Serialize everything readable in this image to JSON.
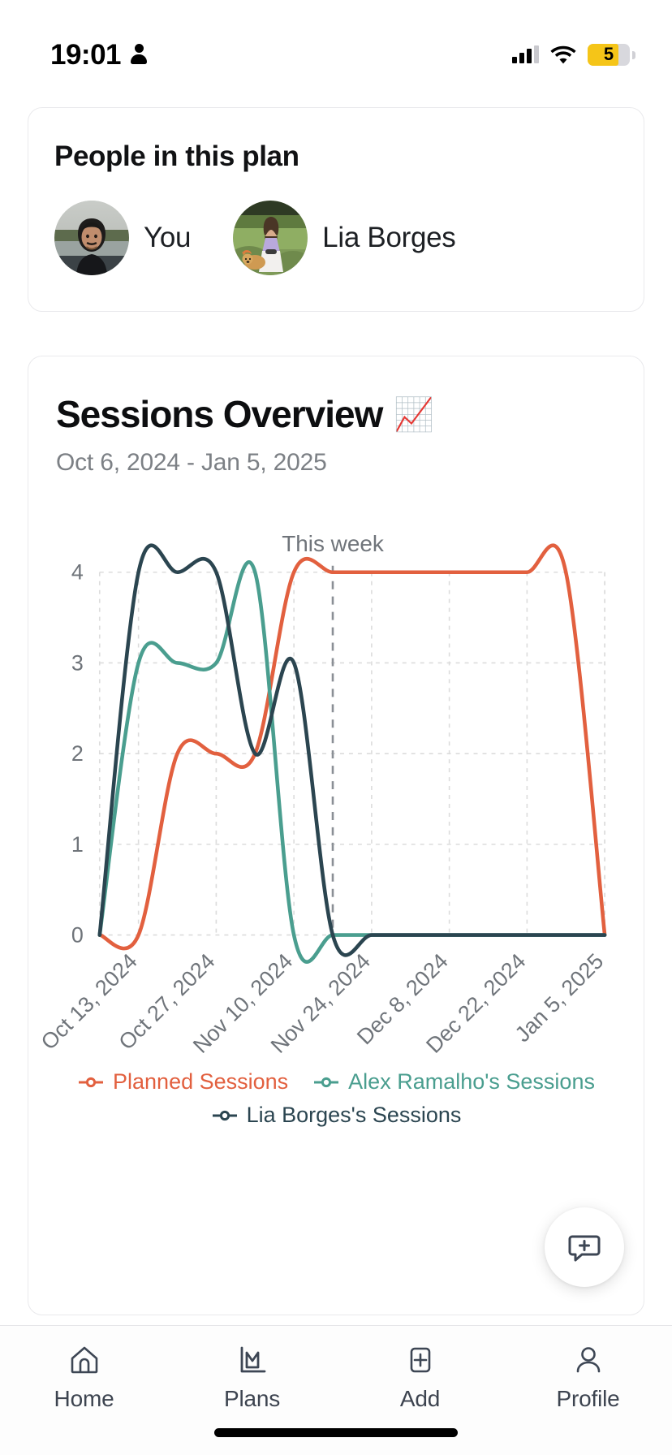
{
  "status_bar": {
    "time": "19:01",
    "person_icon": "person-icon",
    "signal_icon": "cellular-signal-icon",
    "wifi_icon": "wifi-icon",
    "battery_level": "5",
    "battery_color": "#f5c518"
  },
  "people_card": {
    "title": "People in this plan",
    "members": [
      {
        "name": "You",
        "avatar": "avatar-you"
      },
      {
        "name": "Lia Borges",
        "avatar": "avatar-lia-borges"
      }
    ]
  },
  "chart_card": {
    "title": "Sessions Overview",
    "title_emoji": "📈",
    "date_range": "Oct 6, 2024 - Jan 5, 2025"
  },
  "fab": {
    "icon": "chat-add-icon",
    "label": ""
  },
  "tab_bar": {
    "items": [
      {
        "label": "Home",
        "icon": "home-icon",
        "active": false
      },
      {
        "label": "Plans",
        "icon": "chart-icon",
        "active": true
      },
      {
        "label": "Add",
        "icon": "plus-square-icon",
        "active": false
      },
      {
        "label": "Profile",
        "icon": "person-outline-icon",
        "active": false
      }
    ]
  },
  "chart_data": {
    "type": "line",
    "title": "Sessions Overview",
    "subtitle": "Oct 6, 2024 - Jan 5, 2025",
    "xlabel": "",
    "ylabel": "",
    "ylim": [
      0,
      4
    ],
    "yticks": [
      0,
      1,
      2,
      3,
      4
    ],
    "grid": true,
    "legend_position": "bottom",
    "annotation": {
      "text": "This week",
      "x": "Nov 17, 2024",
      "style": "dashed-vertical-line"
    },
    "x": [
      "Oct 6, 2024",
      "Oct 13, 2024",
      "Oct 20, 2024",
      "Oct 27, 2024",
      "Nov 3, 2024",
      "Nov 10, 2024",
      "Nov 17, 2024",
      "Nov 24, 2024",
      "Dec 1, 2024",
      "Dec 8, 2024",
      "Dec 15, 2024",
      "Dec 22, 2024",
      "Dec 29, 2024",
      "Jan 5, 2025"
    ],
    "xticks": [
      "Oct 13, 2024",
      "Oct 27, 2024",
      "Nov 10, 2024",
      "Nov 24, 2024",
      "Dec 8, 2024",
      "Dec 22, 2024",
      "Jan 5, 2025"
    ],
    "series": [
      {
        "name": "Planned Sessions",
        "color": "#e2603f",
        "values": [
          0,
          0,
          2,
          2,
          2,
          4,
          4,
          4,
          4,
          4,
          4,
          4,
          4,
          0
        ]
      },
      {
        "name": "Alex Ramalho's Sessions",
        "color": "#4a9e8f",
        "values": [
          0,
          3,
          3,
          3,
          4,
          0,
          0,
          0,
          0,
          0,
          0,
          0,
          0,
          0
        ]
      },
      {
        "name": "Lia Borges's Sessions",
        "color": "#2b4550",
        "values": [
          0,
          4,
          4,
          4,
          2,
          3,
          0,
          0,
          0,
          0,
          0,
          0,
          0,
          0
        ]
      }
    ]
  }
}
